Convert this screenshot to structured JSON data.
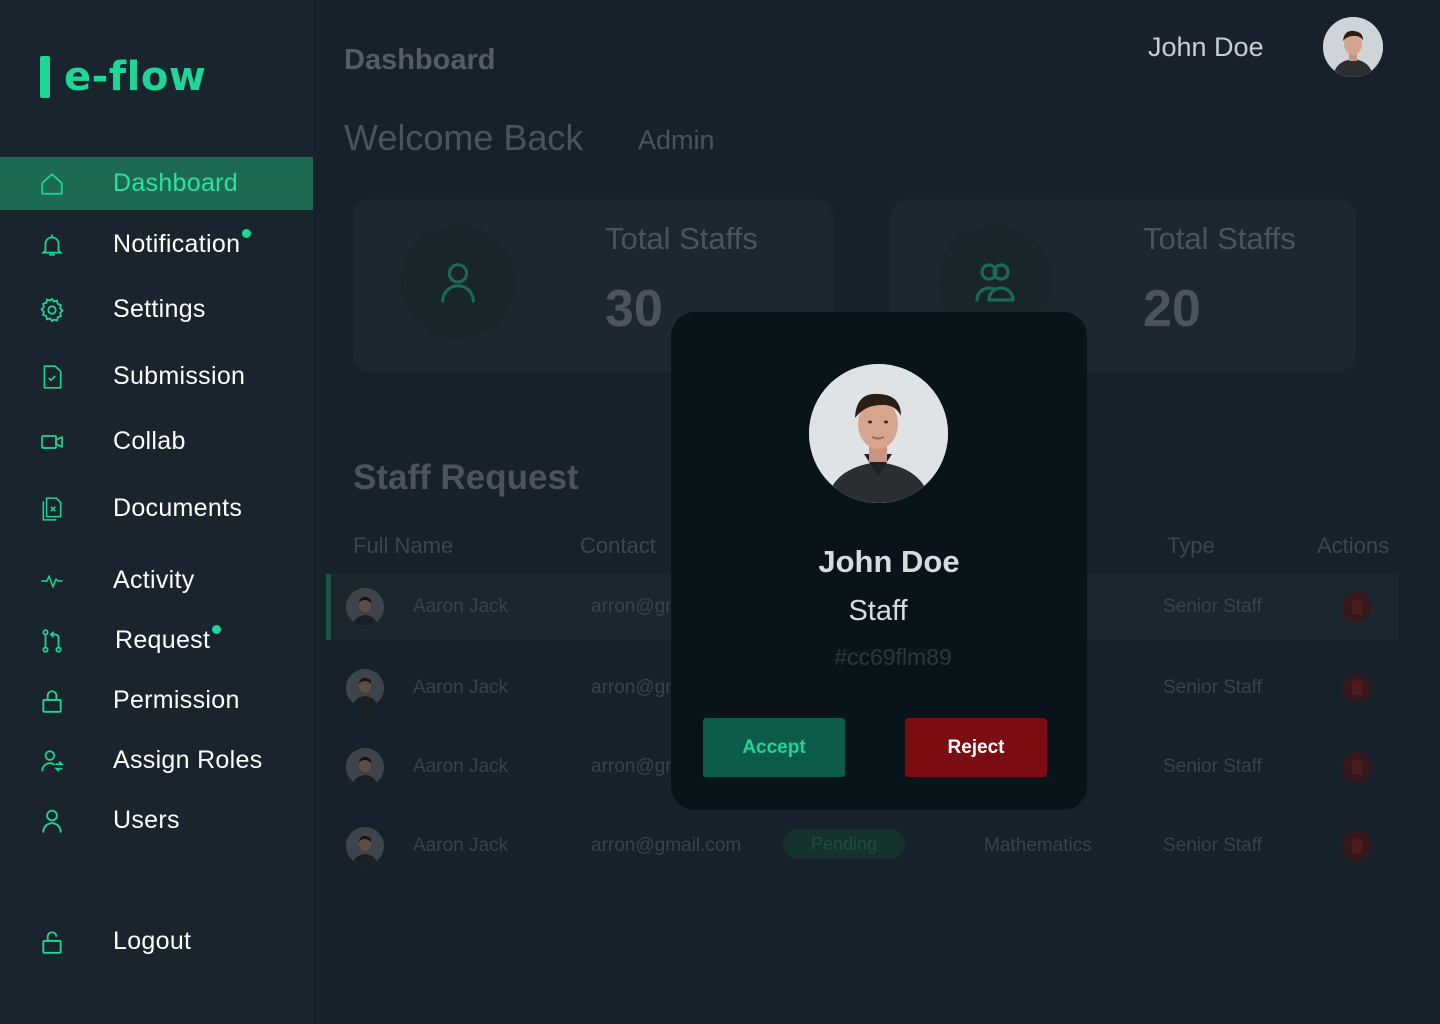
{
  "brand": {
    "name": "e-flow",
    "color": "#1ed796"
  },
  "sidebar": {
    "items": [
      {
        "label": "Dashboard",
        "icon": "home-icon",
        "active": true,
        "badge": false
      },
      {
        "label": "Notification",
        "icon": "bell-icon",
        "active": false,
        "badge": true
      },
      {
        "label": "Settings",
        "icon": "gear-icon",
        "active": false,
        "badge": false
      },
      {
        "label": "Submission",
        "icon": "file-check-icon",
        "active": false,
        "badge": false
      },
      {
        "label": "Collab",
        "icon": "video-icon",
        "active": false,
        "badge": false
      },
      {
        "label": "Documents",
        "icon": "documents-icon",
        "active": false,
        "badge": false
      },
      {
        "label": "Activity",
        "icon": "activity-icon",
        "active": false,
        "badge": false
      },
      {
        "label": "Request",
        "icon": "git-pull-request-icon",
        "active": false,
        "badge": true
      },
      {
        "label": "Permission",
        "icon": "lock-icon",
        "active": false,
        "badge": false
      },
      {
        "label": "Assign Roles",
        "icon": "user-assign-icon",
        "active": false,
        "badge": false
      },
      {
        "label": "Users",
        "icon": "user-icon",
        "active": false,
        "badge": false
      }
    ],
    "logout": {
      "label": "Logout",
      "icon": "unlock-icon"
    }
  },
  "header": {
    "title": "Dashboard",
    "welcome": "Welcome Back",
    "role": "Admin",
    "user_name": "John Doe"
  },
  "stats": [
    {
      "label": "Total Staffs",
      "value": "30",
      "icon": "user-icon"
    },
    {
      "label": "Total Staffs",
      "value": "20",
      "icon": "users-group-icon"
    }
  ],
  "staff_request": {
    "title": "Staff Request",
    "columns": [
      "Full Name",
      "Contact",
      "Type",
      "Actions"
    ],
    "rows": [
      {
        "name": "Aaron Jack",
        "contact": "arron@gm",
        "status": "",
        "subject": "",
        "type": "Senior Staff"
      },
      {
        "name": "Aaron Jack",
        "contact": "arron@gm",
        "status": "",
        "subject": "",
        "type": "Senior Staff"
      },
      {
        "name": "Aaron Jack",
        "contact": "arron@gm",
        "status": "",
        "subject": "",
        "type": "Senior Staff"
      },
      {
        "name": "Aaron Jack",
        "contact": "arron@gmail.com",
        "status": "Pending",
        "subject": "Mathematics",
        "type": "Senior Staff"
      }
    ]
  },
  "modal": {
    "name": "John Doe",
    "role": "Staff",
    "id": "#cc69flm89",
    "accept_label": "Accept",
    "reject_label": "Reject"
  },
  "colors": {
    "accent": "#1ed796",
    "active_nav_bg": "#1d6a52",
    "accept_bg": "#0d5c4b",
    "reject_bg": "#7a0c12",
    "sidebar_bg": "#1a242e",
    "main_bg": "#17212b",
    "modal_bg": "#08141a"
  }
}
